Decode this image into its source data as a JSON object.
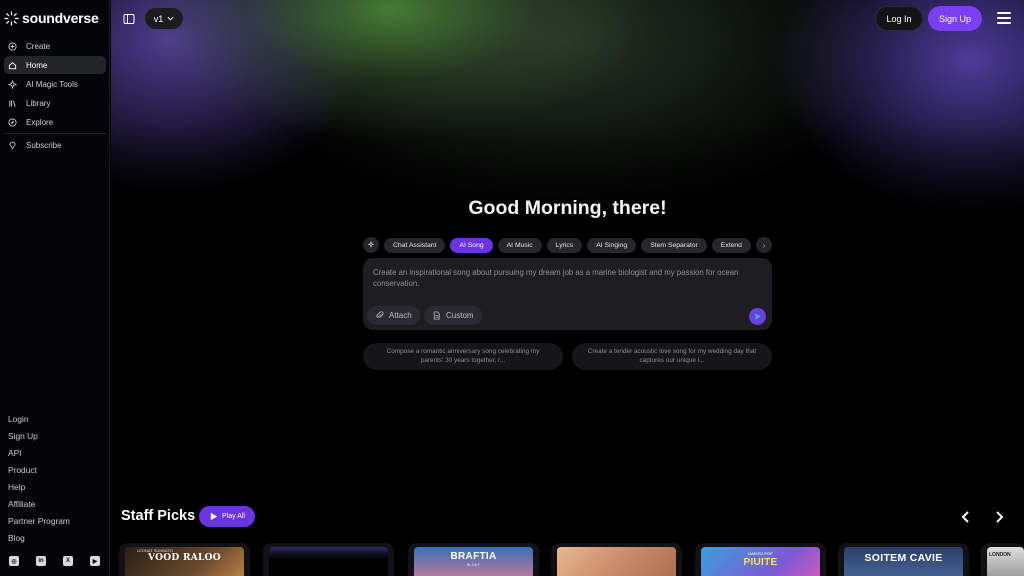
{
  "brand": {
    "name": "soundverse"
  },
  "sidebar": {
    "items": [
      {
        "label": "Create",
        "icon": "plus-circle-icon"
      },
      {
        "label": "Home",
        "icon": "home-icon",
        "active": true
      },
      {
        "label": "AI Magic Tools",
        "icon": "sparkle-icon"
      },
      {
        "label": "Library",
        "icon": "library-icon"
      },
      {
        "label": "Explore",
        "icon": "compass-icon"
      }
    ],
    "subscribe": {
      "label": "Subscribe",
      "icon": "diamond-icon"
    },
    "bottom_links": [
      "Login",
      "Sign Up",
      "API",
      "Product",
      "Help",
      "Affiliate",
      "Partner Program",
      "Blog"
    ],
    "socials": [
      "instagram-icon",
      "linkedin-icon",
      "x-icon",
      "youtube-icon"
    ]
  },
  "header": {
    "version": "v1",
    "login_label": "Log In",
    "signup_label": "Sign Up"
  },
  "main": {
    "greeting": "Good Morning, there!",
    "tabs": [
      "Chat Assistant",
      "AI Song",
      "AI Music",
      "Lyrics",
      "AI Singing",
      "Stem Separator",
      "Extend"
    ],
    "active_tab": "AI Song",
    "prompt_placeholder": "Create an inspirational song about pursuing my dream job as a marine biologist and my passion for ocean conservation.",
    "attach_label": "Attach",
    "custom_label": "Custom",
    "suggestions": [
      "Compose a romantic anniversary song celebrating my parents' 30 years together, r...",
      "Create a tender acoustic love song for my wedding day that captures our unique l..."
    ]
  },
  "staff_picks": {
    "title": "Staff Picks",
    "play_all_label": "Play All",
    "cards": [
      {
        "title": "VOOD RALOO",
        "subtitle": "LEONAT SUNBATO"
      },
      {
        "title": "",
        "subtitle": ""
      },
      {
        "title": "BRAFTIA",
        "subtitle": "BL DA F"
      },
      {
        "title": "",
        "subtitle": ""
      },
      {
        "title": "PIUITE",
        "subtitle": "IAMERZ POP"
      },
      {
        "title": "SOITEM CAVIE",
        "subtitle": ""
      },
      {
        "title": "",
        "subtitle": "LONDON"
      }
    ]
  },
  "colors": {
    "accent": "#7b3ff2",
    "background": "#000000",
    "surface": "#1e1e22"
  }
}
